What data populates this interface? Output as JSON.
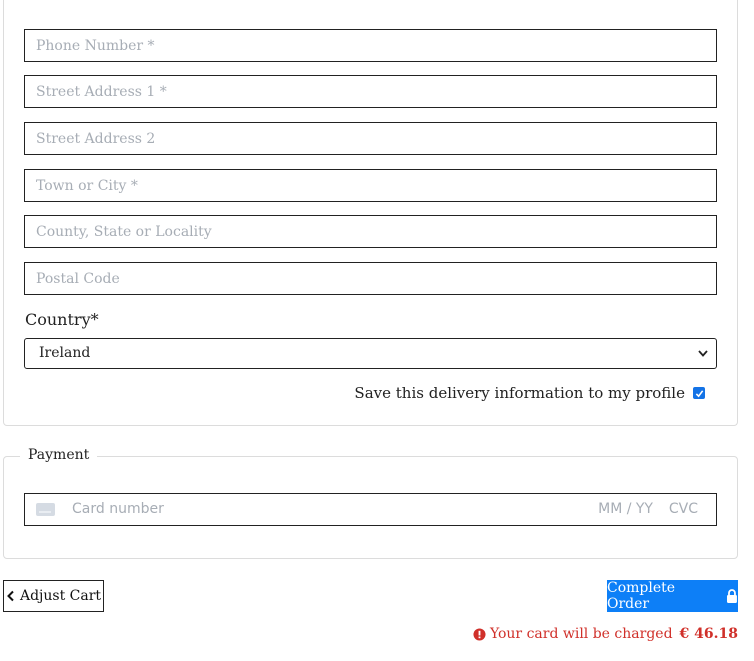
{
  "delivery": {
    "fields": [
      {
        "name": "phone",
        "placeholder": "Phone Number *",
        "value": ""
      },
      {
        "name": "street1",
        "placeholder": "Street Address 1 *",
        "value": ""
      },
      {
        "name": "street2",
        "placeholder": "Street Address 2",
        "value": ""
      },
      {
        "name": "town",
        "placeholder": "Town or City *",
        "value": ""
      },
      {
        "name": "county",
        "placeholder": "County, State or Locality",
        "value": ""
      },
      {
        "name": "postcode",
        "placeholder": "Postal Code",
        "value": ""
      }
    ],
    "country_label": "Country*",
    "country_value": "Ireland",
    "save_label": "Save this delivery information to my profile",
    "save_checked": true
  },
  "payment": {
    "legend": "Payment",
    "card_placeholder": "Card number",
    "expiry_placeholder": "MM / YY",
    "cvc_placeholder": "CVC"
  },
  "actions": {
    "adjust_label": "Adjust Cart",
    "complete_label": "Complete Order",
    "charge_text": "Your card will be charged",
    "charge_amount": "€ 46.18"
  },
  "colors": {
    "accent": "#0d7ff7",
    "error": "#d0302a",
    "checkbox": "#1473e6"
  }
}
